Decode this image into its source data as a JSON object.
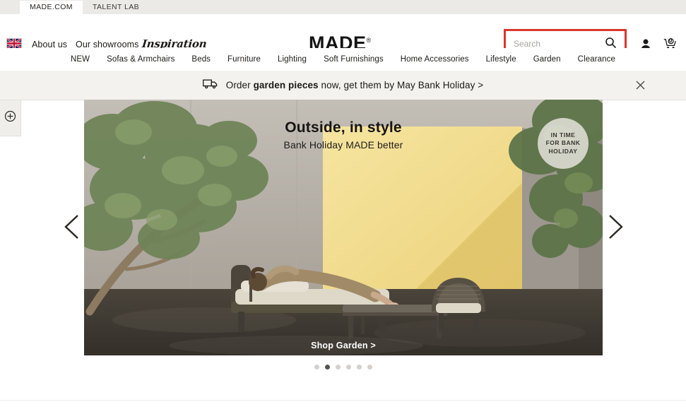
{
  "browser": {
    "tabs": [
      {
        "label": "MADE.COM",
        "active": true
      },
      {
        "label": "TALENT LAB",
        "active": false
      }
    ]
  },
  "header": {
    "flag_icon": "uk-flag-icon",
    "links": [
      {
        "label": "About us"
      },
      {
        "label": "Our showrooms"
      },
      {
        "label": "Inspiration"
      }
    ],
    "logo": {
      "text": "MADE",
      "mark": "®"
    },
    "search": {
      "placeholder": "Search",
      "value": "",
      "icon": "search-icon",
      "highlight_color": "#d9372c",
      "highlighted": true
    },
    "account_icon": "user-icon",
    "cart": {
      "icon": "cart-icon",
      "count": "0"
    }
  },
  "main_nav": {
    "items": [
      {
        "label": "NEW"
      },
      {
        "label": "Sofas & Armchairs"
      },
      {
        "label": "Beds"
      },
      {
        "label": "Furniture"
      },
      {
        "label": "Lighting"
      },
      {
        "label": "Soft Furnishings"
      },
      {
        "label": "Home Accessories"
      },
      {
        "label": "Lifestyle"
      },
      {
        "label": "Garden"
      },
      {
        "label": "Clearance"
      }
    ]
  },
  "promo_banner": {
    "icon": "delivery-truck-icon",
    "text_before": "Order ",
    "text_bold": "garden pieces",
    "text_after": " now, get them by May Bank Holiday >",
    "close_icon": "close-icon",
    "background": "#f4f2ef"
  },
  "side_tab": {
    "icon": "plus-circle-icon"
  },
  "hero": {
    "headline": "Outside, in style",
    "subhead": "Bank Holiday MADE better",
    "cta": "Shop Garden >",
    "badge_lines": [
      "IN TIME",
      "FOR BANK",
      "HOLIDAY"
    ],
    "prev_icon": "chevron-left-icon",
    "next_icon": "chevron-right-icon",
    "colors": {
      "wall_grey": "#b4aea6",
      "wall_yellow": "#f2dd8e",
      "floor": "#3c372f",
      "shadow": "#d8c071"
    }
  },
  "carousel": {
    "total": 6,
    "active_index": 1
  }
}
